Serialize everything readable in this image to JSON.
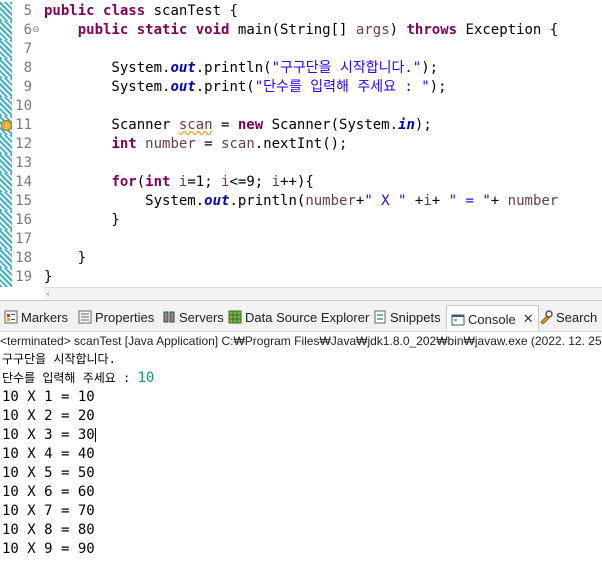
{
  "editor": {
    "lines": [
      {
        "num": "5",
        "fold": "",
        "parts": [
          {
            "t": "public",
            "c": "kw"
          },
          {
            "t": " "
          },
          {
            "t": "class",
            "c": "kw"
          },
          {
            "t": " scanTest {"
          }
        ]
      },
      {
        "num": "6",
        "fold": "⊖",
        "parts": [
          {
            "t": "    "
          },
          {
            "t": "public",
            "c": "kw"
          },
          {
            "t": " "
          },
          {
            "t": "static",
            "c": "kw"
          },
          {
            "t": " "
          },
          {
            "t": "void",
            "c": "kw"
          },
          {
            "t": " main(String[] "
          },
          {
            "t": "args",
            "c": "var"
          },
          {
            "t": ") "
          },
          {
            "t": "throws",
            "c": "kw"
          },
          {
            "t": " Exception {"
          }
        ]
      },
      {
        "num": "7",
        "fold": "",
        "parts": []
      },
      {
        "num": "8",
        "fold": "",
        "parts": [
          {
            "t": "        System."
          },
          {
            "t": "out",
            "c": "fld"
          },
          {
            "t": ".println("
          },
          {
            "t": "\"구구단을 시작합니다.\"",
            "c": "st"
          },
          {
            "t": ");"
          }
        ]
      },
      {
        "num": "9",
        "fold": "",
        "parts": [
          {
            "t": "        System."
          },
          {
            "t": "out",
            "c": "fld"
          },
          {
            "t": ".print("
          },
          {
            "t": "\"단수를 입력해 주세요 : \"",
            "c": "st"
          },
          {
            "t": ");"
          }
        ]
      },
      {
        "num": "10",
        "fold": "",
        "parts": []
      },
      {
        "num": "11",
        "fold": "",
        "warn": true,
        "parts": [
          {
            "t": "        Scanner "
          },
          {
            "t": "scan",
            "c": "var squig"
          },
          {
            "t": " = "
          },
          {
            "t": "new",
            "c": "kw"
          },
          {
            "t": " Scanner(System."
          },
          {
            "t": "in",
            "c": "fld"
          },
          {
            "t": ");"
          }
        ]
      },
      {
        "num": "12",
        "fold": "",
        "parts": [
          {
            "t": "        "
          },
          {
            "t": "int",
            "c": "kw"
          },
          {
            "t": " "
          },
          {
            "t": "number",
            "c": "var"
          },
          {
            "t": " = "
          },
          {
            "t": "scan",
            "c": "var"
          },
          {
            "t": ".nextInt();"
          }
        ]
      },
      {
        "num": "13",
        "fold": "",
        "parts": []
      },
      {
        "num": "14",
        "fold": "",
        "parts": [
          {
            "t": "        "
          },
          {
            "t": "for",
            "c": "kw"
          },
          {
            "t": "("
          },
          {
            "t": "int",
            "c": "kw"
          },
          {
            "t": " "
          },
          {
            "t": "i",
            "c": "var"
          },
          {
            "t": "=1; "
          },
          {
            "t": "i",
            "c": "var"
          },
          {
            "t": "<=9; "
          },
          {
            "t": "i",
            "c": "var"
          },
          {
            "t": "++){"
          }
        ]
      },
      {
        "num": "15",
        "fold": "",
        "parts": [
          {
            "t": "            System."
          },
          {
            "t": "out",
            "c": "fld"
          },
          {
            "t": ".println("
          },
          {
            "t": "number",
            "c": "var"
          },
          {
            "t": "+"
          },
          {
            "t": "\" X \"",
            "c": "st"
          },
          {
            "t": " +"
          },
          {
            "t": "i",
            "c": "var"
          },
          {
            "t": "+ "
          },
          {
            "t": "\" = \"",
            "c": "st"
          },
          {
            "t": "+ "
          },
          {
            "t": "number",
            "c": "var"
          }
        ]
      },
      {
        "num": "16",
        "fold": "",
        "parts": [
          {
            "t": "        }"
          }
        ]
      },
      {
        "num": "17",
        "fold": "",
        "parts": []
      },
      {
        "num": "18",
        "fold": "",
        "parts": [
          {
            "t": "    }"
          }
        ]
      },
      {
        "num": "19",
        "fold": "",
        "parts": [
          {
            "t": "}"
          }
        ]
      }
    ]
  },
  "tabs": [
    {
      "label": "Markers",
      "icon": "markers-icon",
      "active": false
    },
    {
      "label": "Properties",
      "icon": "properties-icon",
      "active": false
    },
    {
      "label": "Servers",
      "icon": "servers-icon",
      "active": false
    },
    {
      "label": "Data Source Explorer",
      "icon": "data-source-explorer-icon",
      "active": false
    },
    {
      "label": "Snippets",
      "icon": "snippets-icon",
      "active": false
    },
    {
      "label": "Console",
      "icon": "console-icon",
      "active": true
    },
    {
      "label": "Search",
      "icon": "search-icon",
      "active": false
    }
  ],
  "console": {
    "header": "<terminated> scanTest [Java Application] C:₩Program Files₩Java₩jdk1.8.0_202₩bin₩javaw.exe  (2022. 12. 25.",
    "line1": "구구단을 시작합니다.",
    "prompt": "단수를 입력해 주세요 : ",
    "input": "10",
    "results": [
      "10 X 1 = 10",
      "10 X 2 = 20",
      "10 X 3 = 30",
      "10 X 4 = 40",
      "10 X 5 = 50",
      "10 X 6 = 60",
      "10 X 7 = 70",
      "10 X 8 = 80",
      "10 X 9 = 90"
    ]
  },
  "colors": {
    "keyword": "#7f0055",
    "string": "#2a00ff",
    "field": "#0000c0",
    "variable": "#6a3e3e",
    "console_input": "#0f9a70"
  }
}
